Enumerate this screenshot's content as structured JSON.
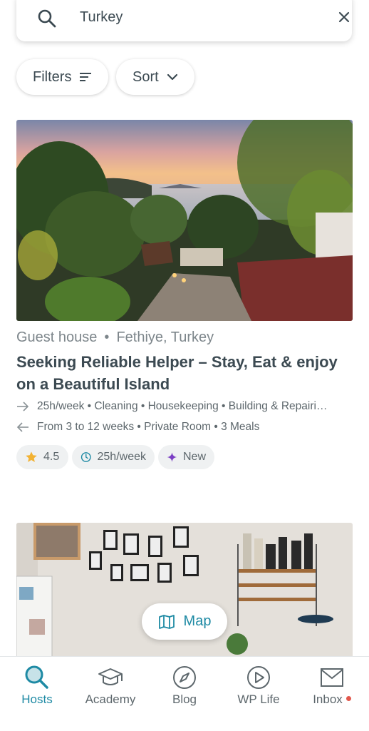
{
  "search": {
    "query": "Turkey"
  },
  "filters": {
    "filters_label": "Filters",
    "sort_label": "Sort"
  },
  "listing": {
    "type": "Guest house",
    "location": "Fethiye, Turkey",
    "title": "Seeking Reliable Helper – Stay, Eat & enjoy on a Beautiful Island",
    "tasks": "25h/week • Cleaning • Housekeeping • Building & Repairi…",
    "details": "From 3 to 12 weeks • Private Room • 3 Meals",
    "rating": "4.5",
    "hours_badge": "25h/week",
    "new_badge": "New"
  },
  "map_button": {
    "label": "Map"
  },
  "nav": {
    "items": [
      {
        "label": "Hosts",
        "icon": "search-icon",
        "active": true
      },
      {
        "label": "Academy",
        "icon": "graduation-cap-icon",
        "active": false
      },
      {
        "label": "Blog",
        "icon": "compass-icon",
        "active": false
      },
      {
        "label": "WP Life",
        "icon": "play-icon",
        "active": false
      },
      {
        "label": "Inbox",
        "icon": "mail-icon",
        "active": false
      }
    ]
  },
  "colors": {
    "accent": "#1e8aa4",
    "text": "#3c4a52",
    "star": "#f2b233",
    "new": "#7b3fc4",
    "notification": "#e2574c"
  }
}
